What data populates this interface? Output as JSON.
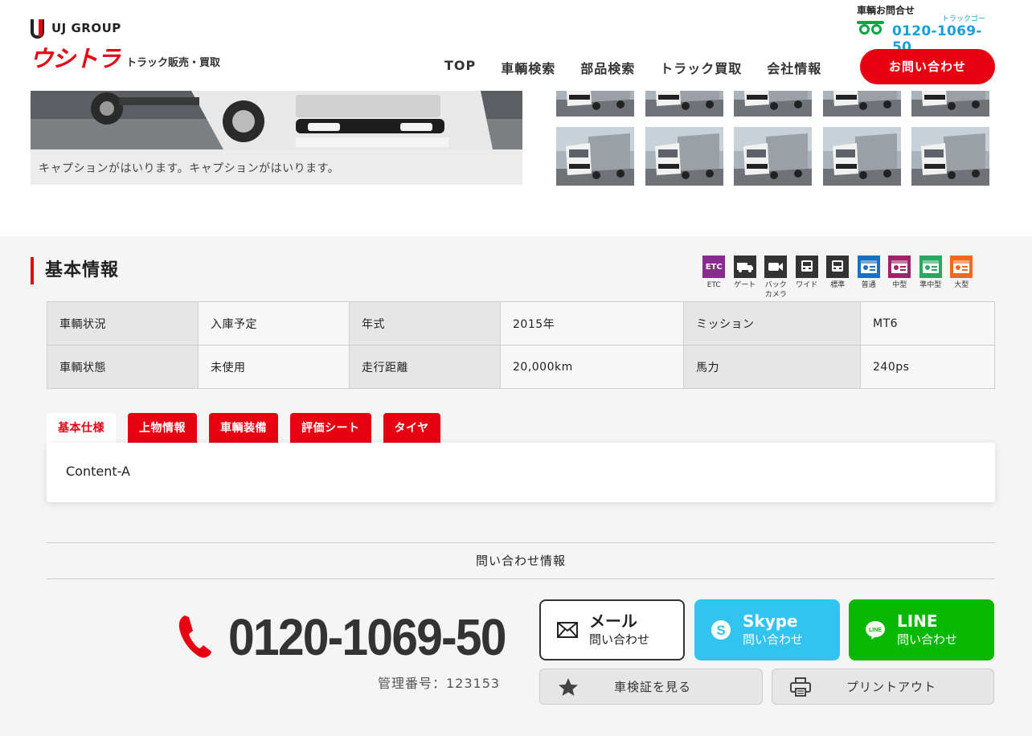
{
  "header": {
    "group_name": "UJ GROUP",
    "brand_name": "ウシトラ",
    "brand_tagline": "トラック販売・買取",
    "tel_label": "車輌お問合せ",
    "tel_kana": "トラックゴー",
    "tel_number": "0120-1069-50",
    "nav": [
      "TOP",
      "車輌検索",
      "部品検索",
      "トラック買取",
      "会社情報"
    ],
    "contact_button": "お問い合わせ"
  },
  "gallery": {
    "caption": "キャプションがはいります。キャプションがはいります。"
  },
  "basic_info": {
    "title": "基本情報",
    "features": [
      {
        "label": "ETC",
        "icon": "etc-icon",
        "color": "#8b2a8f",
        "text": "ETC"
      },
      {
        "label": "ゲート",
        "icon": "tail-gate-truck-icon",
        "color": "#333333"
      },
      {
        "label": "バック\nカメラ",
        "icon": "video-camera-icon",
        "color": "#333333"
      },
      {
        "label": "ワイド",
        "icon": "wide-cab-icon",
        "color": "#333333"
      },
      {
        "label": "標準",
        "icon": "standard-cab-icon",
        "color": "#333333"
      },
      {
        "label": "普通",
        "icon": "license-card-icon",
        "color": "#1a6fc0"
      },
      {
        "label": "中型",
        "icon": "license-card-icon",
        "color": "#a0226a"
      },
      {
        "label": "準中型",
        "icon": "license-card-icon",
        "color": "#2aa860"
      },
      {
        "label": "大型",
        "icon": "license-card-icon",
        "color": "#f06a1e"
      }
    ],
    "rows": [
      [
        "車輌状況",
        "入庫予定",
        "年式",
        "2015年",
        "ミッション",
        "MT6"
      ],
      [
        "車輌状態",
        "未使用",
        "走行距離",
        "20,000km",
        "馬力",
        "240ps"
      ]
    ]
  },
  "tabs": {
    "items": [
      "基本仕様",
      "上物情報",
      "車輌装備",
      "評価シート",
      "タイヤ"
    ],
    "active": 0,
    "content": "Content-A"
  },
  "inquiry": {
    "title": "問い合わせ情報",
    "phone": "0120-1069-50",
    "management_no": "管理番号：123153",
    "mail": {
      "title": "メール",
      "sub": "問い合わせ"
    },
    "skype": {
      "title": "Skype",
      "sub": "問い合わせ"
    },
    "line": {
      "title": "LINE",
      "sub": "問い合わせ",
      "badge": "LINE"
    },
    "shaken": "車検証を見る",
    "print": "プリントアウト"
  }
}
